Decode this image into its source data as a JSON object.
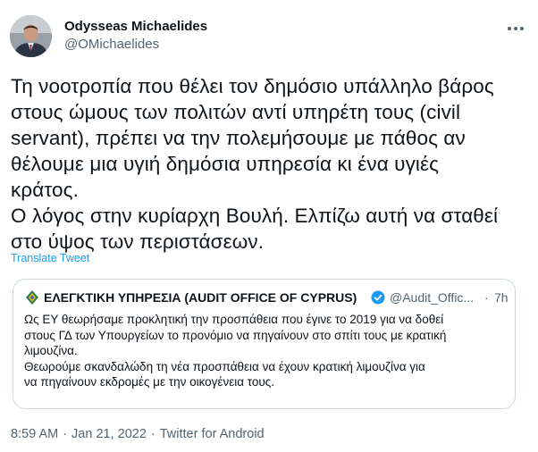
{
  "author": {
    "name": "Odysseas Michaelides",
    "handle": "@OMichaelides",
    "avatar_alt": "Odysseas Michaelides"
  },
  "tweet": {
    "lines": [
      "Τη νοοτροπία που θέλει τον δημόσιο υπάλληλο βάρος",
      "στους ώμους των πολιτών αντί υπηρέτη τους (civil",
      "servant), πρέπει να την πολεμήσουμε με πάθος αν",
      "θέλουμε μια υγιή δημόσια υπηρεσία κι ένα υγιές",
      "κράτος.",
      "Ο λόγος στην κυρίαρχη Βουλή. Ελπίζω αυτή να σταθεί",
      "στο ύψος των περιστάσεων."
    ],
    "translate_label": "Translate Tweet"
  },
  "quote": {
    "name": "ΕΛΕΓΚΤΙΚΗ ΥΠΗΡΕΣΙΑ (AUDIT OFFICE OF CYPRUS)",
    "handle": "@Audit_Offic...",
    "dot": "·",
    "time": "7h",
    "lines": [
      "Ως ΕΥ θεωρήσαμε προκλητική την προσπάθεια που έγινε το 2019 για να δοθεί",
      "στους ΓΔ των Υπουργείων το προνόμιο να πηγαίνουν στο σπίτι τους με κρατική",
      "λιμουζίνα.",
      "Θεωρούμε σκανδαλώδη τη νέα προσπάθεια να έχουν κρατική λιμουζίνα για",
      "να πηγαίνουν εκδρομές με την οικογένεια τους."
    ]
  },
  "meta": {
    "time": "8:59 AM",
    "sep1": "·",
    "date": "Jan 21, 2022",
    "sep2": "·",
    "source": "Twitter for Android"
  },
  "colors": {
    "text": "#0f1419",
    "secondary": "#536471",
    "link": "#1d9bf0",
    "border": "#cfd9de",
    "verified": "#1d9bf0"
  },
  "icons": [
    "avatar",
    "more-options-icon",
    "audit-office-logo-icon",
    "verified-badge-icon"
  ]
}
